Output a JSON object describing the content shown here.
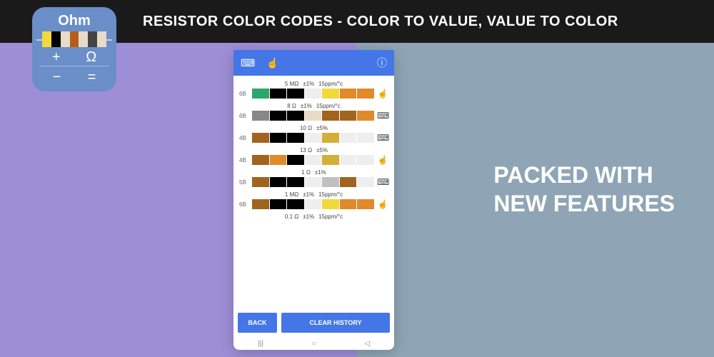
{
  "title": "RESISTOR COLOR CODES - COLOR TO VALUE, VALUE TO COLOR",
  "tagline": {
    "line1": "PACKED WITH",
    "line2": "NEW FEATURES"
  },
  "icon": {
    "label": "Ohm",
    "row1": {
      "a": "+",
      "b": "Ω"
    },
    "row2": {
      "a": "−",
      "b": "="
    },
    "bands": [
      "#f2d83b",
      "#000",
      "#e8dcc8",
      "#b85c1c",
      "#e8dcc8",
      "#444",
      "#e8dcc8"
    ]
  },
  "phone": {
    "back": "BACK",
    "clear": "CLEAR HISTORY",
    "entries": [
      {
        "bands_label": "6B",
        "value": "5 MΩ",
        "tol": "±1%",
        "tc": "15ppm/°c",
        "colors": [
          "#2aa86a",
          "#000",
          "#000",
          "#eee",
          "#f2d83b",
          "#e08a2a",
          "#e08a2a"
        ],
        "icon": "☝"
      },
      {
        "bands_label": "6B",
        "value": "8 Ω",
        "tol": "±1%",
        "tc": "15ppm/°c",
        "colors": [
          "#888",
          "#000",
          "#000",
          "#e8dcc8",
          "#a0641e",
          "#a0641e",
          "#e08a2a"
        ],
        "icon": "⌨"
      },
      {
        "bands_label": "4B",
        "value": "10 Ω",
        "tol": "±5%",
        "tc": "",
        "colors": [
          "#a0641e",
          "#000",
          "#000",
          "#eee",
          "#d4af37",
          "#eee",
          "#eee"
        ],
        "icon": "⌨"
      },
      {
        "bands_label": "4B",
        "value": "13 Ω",
        "tol": "±5%",
        "tc": "",
        "colors": [
          "#a0641e",
          "#e08a2a",
          "#000",
          "#eee",
          "#d4af37",
          "#eee",
          "#eee"
        ],
        "icon": "☝"
      },
      {
        "bands_label": "5B",
        "value": "1 Ω",
        "tol": "±1%",
        "tc": "",
        "colors": [
          "#a0641e",
          "#000",
          "#000",
          "#eee",
          "#c0c0c0",
          "#a0641e",
          "#eee"
        ],
        "icon": "⌨"
      },
      {
        "bands_label": "6B",
        "value": "1 MΩ",
        "tol": "±1%",
        "tc": "15ppm/°c",
        "colors": [
          "#a0641e",
          "#000",
          "#000",
          "#eee",
          "#f2d83b",
          "#e08a2a",
          "#e08a2a"
        ],
        "icon": "☝"
      },
      {
        "bands_label": "",
        "value": "0.1 Ω",
        "tol": "±1%",
        "tc": "15ppm/°c",
        "colors": [],
        "icon": ""
      }
    ]
  }
}
